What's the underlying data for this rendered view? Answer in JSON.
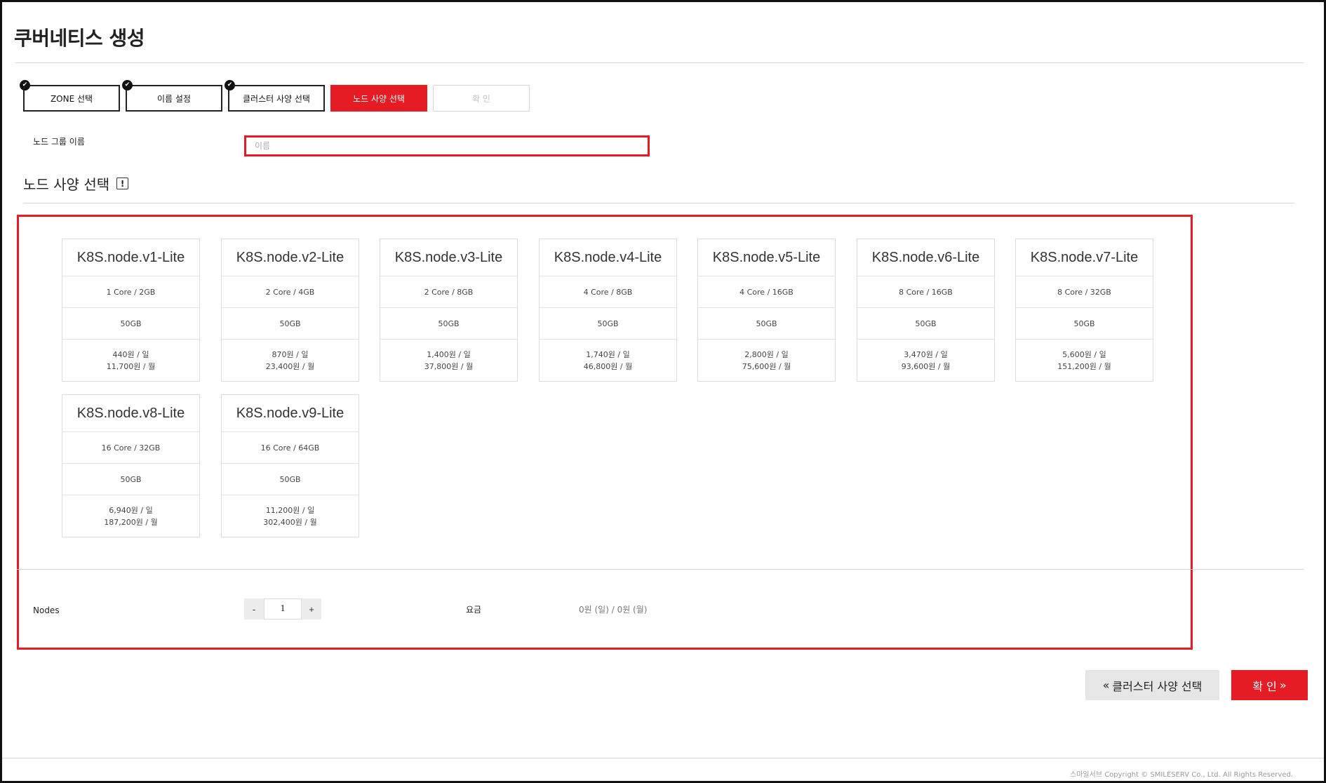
{
  "page": {
    "title": "쿠버네티스 생성"
  },
  "steps": [
    {
      "label": "ZONE 선택",
      "state": "done"
    },
    {
      "label": "이름 설정",
      "state": "done"
    },
    {
      "label": "클러스터 사양 선택",
      "state": "done"
    },
    {
      "label": "노드 사양 선택",
      "state": "active"
    },
    {
      "label": "확 인",
      "state": "disabled"
    }
  ],
  "node_group": {
    "label": "노드 그룹 이름",
    "placeholder": "이름",
    "value": ""
  },
  "spec_section": {
    "title": "노드 사양 선택",
    "info_icon": "!"
  },
  "specs": [
    {
      "name": "K8S.node.v1-Lite",
      "cpu_mem": "1 Core / 2GB",
      "disk": "50GB",
      "daily": "440원 / 일",
      "monthly": "11,700원 / 월"
    },
    {
      "name": "K8S.node.v2-Lite",
      "cpu_mem": "2 Core / 4GB",
      "disk": "50GB",
      "daily": "870원 / 일",
      "monthly": "23,400원 / 월"
    },
    {
      "name": "K8S.node.v3-Lite",
      "cpu_mem": "2 Core / 8GB",
      "disk": "50GB",
      "daily": "1,400원 / 일",
      "monthly": "37,800원 / 월"
    },
    {
      "name": "K8S.node.v4-Lite",
      "cpu_mem": "4 Core / 8GB",
      "disk": "50GB",
      "daily": "1,740원 / 일",
      "monthly": "46,800원 / 월"
    },
    {
      "name": "K8S.node.v5-Lite",
      "cpu_mem": "4 Core / 16GB",
      "disk": "50GB",
      "daily": "2,800원 / 일",
      "monthly": "75,600원 / 월"
    },
    {
      "name": "K8S.node.v6-Lite",
      "cpu_mem": "8 Core / 16GB",
      "disk": "50GB",
      "daily": "3,470원 / 일",
      "monthly": "93,600원 / 월"
    },
    {
      "name": "K8S.node.v7-Lite",
      "cpu_mem": "8 Core / 32GB",
      "disk": "50GB",
      "daily": "5,600원 / 일",
      "monthly": "151,200원 / 월"
    },
    {
      "name": "K8S.node.v8-Lite",
      "cpu_mem": "16 Core / 32GB",
      "disk": "50GB",
      "daily": "6,940원 / 일",
      "monthly": "187,200원 / 월"
    },
    {
      "name": "K8S.node.v9-Lite",
      "cpu_mem": "16 Core / 64GB",
      "disk": "50GB",
      "daily": "11,200원 / 일",
      "monthly": "302,400원 / 월"
    }
  ],
  "nodes": {
    "label": "Nodes",
    "minus": "-",
    "plus": "+",
    "value": "1"
  },
  "fee": {
    "label": "요금",
    "value": "0원 (일) / 0원 (월)"
  },
  "actions": {
    "prev_icon": "«",
    "prev_label": "클러스터 사양 선택",
    "ok_label": "확 인",
    "ok_icon": "»"
  },
  "footer": {
    "copyright": "스마일서브 Copyright © SMILESERV Co., Ltd. All Rights Reserved."
  },
  "colors": {
    "accent": "#e51c23",
    "border": "#dcdcdc",
    "muted": "#999999"
  }
}
